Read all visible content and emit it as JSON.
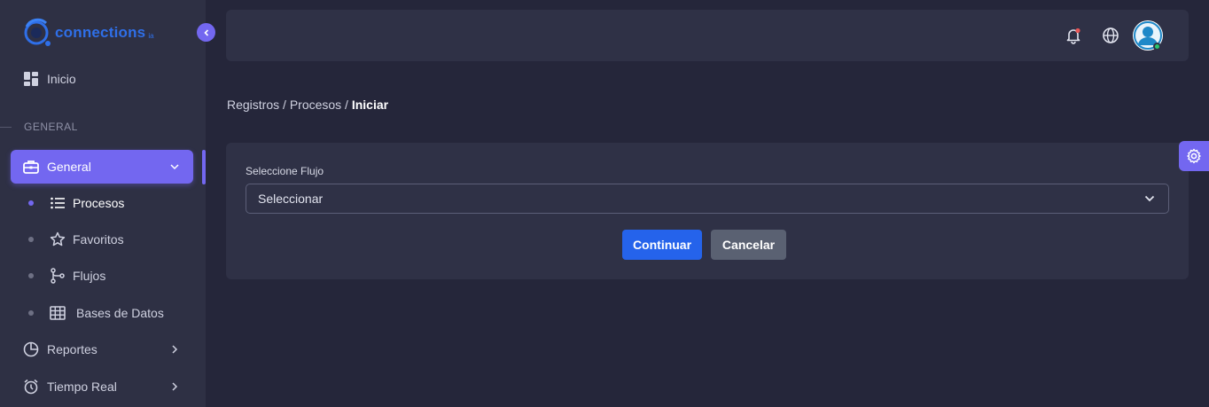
{
  "brand": {
    "name": "connections",
    "suffix": "ia"
  },
  "sidebar": {
    "home": {
      "label": "Inicio",
      "icon": "dashboard-grid-icon"
    },
    "section_title": "GENERAL",
    "active_group": {
      "label": "General",
      "icon": "briefcase-icon"
    },
    "sub_items": [
      {
        "label": "Procesos",
        "icon": "list-icon"
      },
      {
        "label": "Favoritos",
        "icon": "star-icon"
      },
      {
        "label": "Flujos",
        "icon": "git-branch-icon"
      },
      {
        "label": "Bases de Datos",
        "icon": "table-icon"
      }
    ],
    "items": [
      {
        "label": "Reportes",
        "icon": "pie-chart-icon"
      },
      {
        "label": "Tiempo Real",
        "icon": "alarm-clock-icon"
      }
    ]
  },
  "navbar": {
    "icons": [
      "bell-icon",
      "globe-icon",
      "user-avatar"
    ]
  },
  "breadcrumb": {
    "first": "Registros",
    "second": "Procesos",
    "current": "Iniciar",
    "separator": " / "
  },
  "form": {
    "label": "Seleccione Flujo",
    "select_value": "Seleccionar",
    "continue_label": "Continuar",
    "cancel_label": "Cancelar"
  },
  "colors": {
    "accent": "#7367f0",
    "primary_button": "#2563eb",
    "secondary_button": "#5a6172",
    "background": "#25263a",
    "panel": "#2f3146",
    "brand": "#2f6fe8"
  }
}
